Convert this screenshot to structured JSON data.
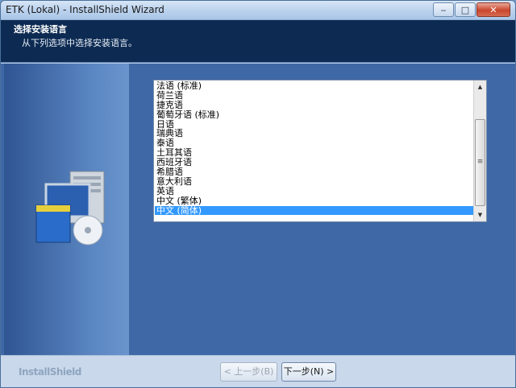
{
  "window": {
    "title": "ETK (Lokal) - InstallShield Wizard",
    "minimize": "‒",
    "maximize": "□",
    "close": "✕"
  },
  "header": {
    "title": "选择安装语言",
    "subtitle": "从下列选项中选择安装语言。"
  },
  "language_list": {
    "items": [
      "法语 (标准)",
      "荷兰语",
      "捷克语",
      "葡萄牙语 (标准)",
      "日语",
      "瑞典语",
      "泰语",
      "土耳其语",
      "西班牙语",
      "希腊语",
      "意大利语",
      "英语",
      "中文 (繁体)",
      "中文 (简体)"
    ],
    "selected": "中文 (简体)"
  },
  "footer": {
    "brand": "InstallShield",
    "back_label": "< 上一步(B)",
    "next_label": "下一步(N) >"
  }
}
